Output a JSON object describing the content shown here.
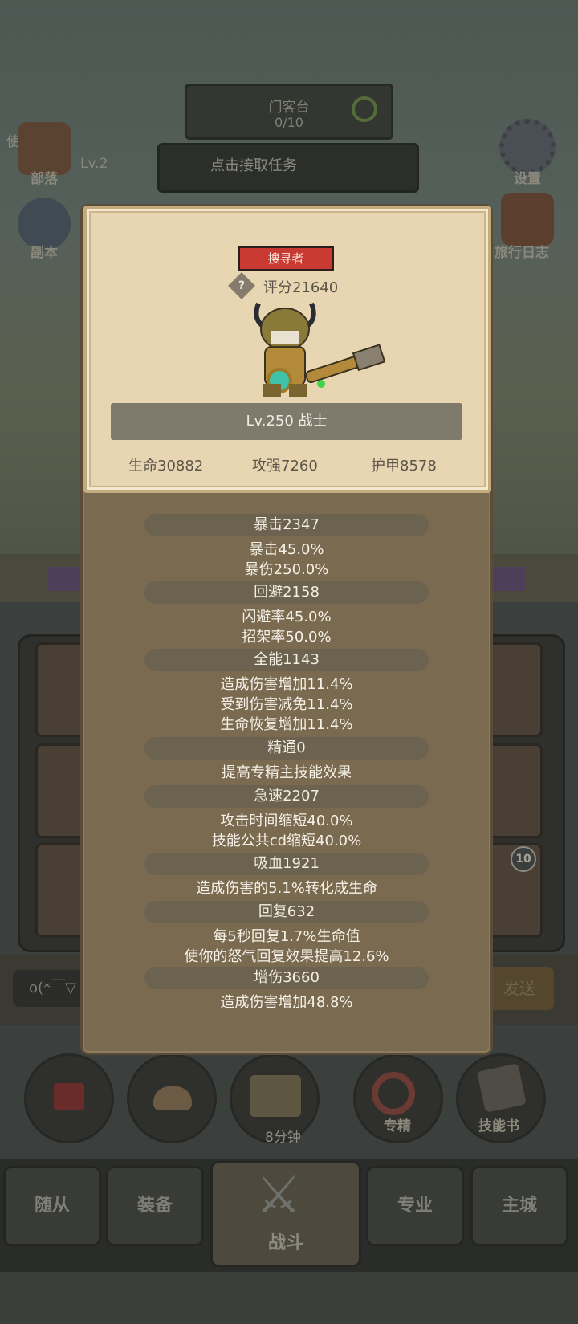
{
  "background": {
    "top_panel": {
      "title": "门客台",
      "progress": "0/10"
    },
    "faction": "使法师",
    "task": {
      "level_text": "Lv.2",
      "task_text": "点击接取任务"
    },
    "side_left": [
      {
        "label": "部落"
      },
      {
        "label": "副本"
      }
    ],
    "side_right": [
      {
        "label": "设置"
      },
      {
        "label": "旅行日志"
      }
    ],
    "chat": {
      "input_text": "o(*￣▽",
      "send_label": "发送"
    },
    "circle_buttons": [
      {
        "label": ""
      },
      {
        "label": ""
      },
      {
        "label": "8分钟"
      },
      {
        "label": "专精"
      },
      {
        "label": "技能书"
      }
    ],
    "tabs": [
      {
        "label": "随从"
      },
      {
        "label": "装备"
      },
      {
        "label": "战斗"
      },
      {
        "label": "专业"
      },
      {
        "label": "主城"
      }
    ],
    "slot_badge": "10"
  },
  "character": {
    "title": "搜寻者",
    "help_icon": "?",
    "score": "评分21640",
    "level_class": "Lv.250 战士",
    "base_stats": {
      "hp": "生命30882",
      "attack": "攻强7260",
      "armor": "护甲8578"
    }
  },
  "stat_groups": [
    {
      "header": "暴击2347",
      "lines": [
        "暴击45.0%",
        "暴伤250.0%"
      ]
    },
    {
      "header": "回避2158",
      "lines": [
        "闪避率45.0%",
        "招架率50.0%"
      ]
    },
    {
      "header": "全能1143",
      "lines": [
        "造成伤害增加11.4%",
        "受到伤害减免11.4%",
        "生命恢复增加11.4%"
      ]
    },
    {
      "header": "精通0",
      "lines": [
        "提高专精主技能效果"
      ]
    },
    {
      "header": "急速2207",
      "lines": [
        "攻击时间缩短40.0%",
        "技能公共cd缩短40.0%"
      ]
    },
    {
      "header": "吸血1921",
      "lines": [
        "造成伤害的5.1%转化成生命"
      ]
    },
    {
      "header": "回复632",
      "lines": [
        "每5秒回复1.7%生命值",
        "使你的怒气回复效果提高12.6%"
      ]
    },
    {
      "header": "增伤3660",
      "lines": [
        "造成伤害增加48.8%"
      ]
    }
  ],
  "colors": {
    "title_badge": "#c83a32",
    "modal_bg": "#7a6a50",
    "card_bg": "#e7d6b1"
  }
}
